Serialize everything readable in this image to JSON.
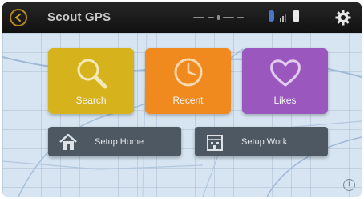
{
  "header": {
    "title": "Scout GPS",
    "back_icon": "back-arrow-icon",
    "settings_icon": "gear-icon"
  },
  "status": {
    "bluetooth_icon": "bluetooth-icon",
    "signal_icon": "signal-icon",
    "battery_icon": "battery-icon"
  },
  "tiles": [
    {
      "label": "Search",
      "icon": "magnifier-icon",
      "color": "#d6b21c"
    },
    {
      "label": "Recent",
      "icon": "clock-icon",
      "color": "#f08a1e"
    },
    {
      "label": "Likes",
      "icon": "heart-icon",
      "color": "#9a58bf"
    }
  ],
  "actions": [
    {
      "label": "Setup Home",
      "icon": "home-icon"
    },
    {
      "label": "Setup Work",
      "icon": "office-icon"
    }
  ],
  "info_label": "i",
  "colors": {
    "statusbar": "#1a1a1a",
    "map_background": "#d6e5f1",
    "action_button": "#4e5863"
  }
}
